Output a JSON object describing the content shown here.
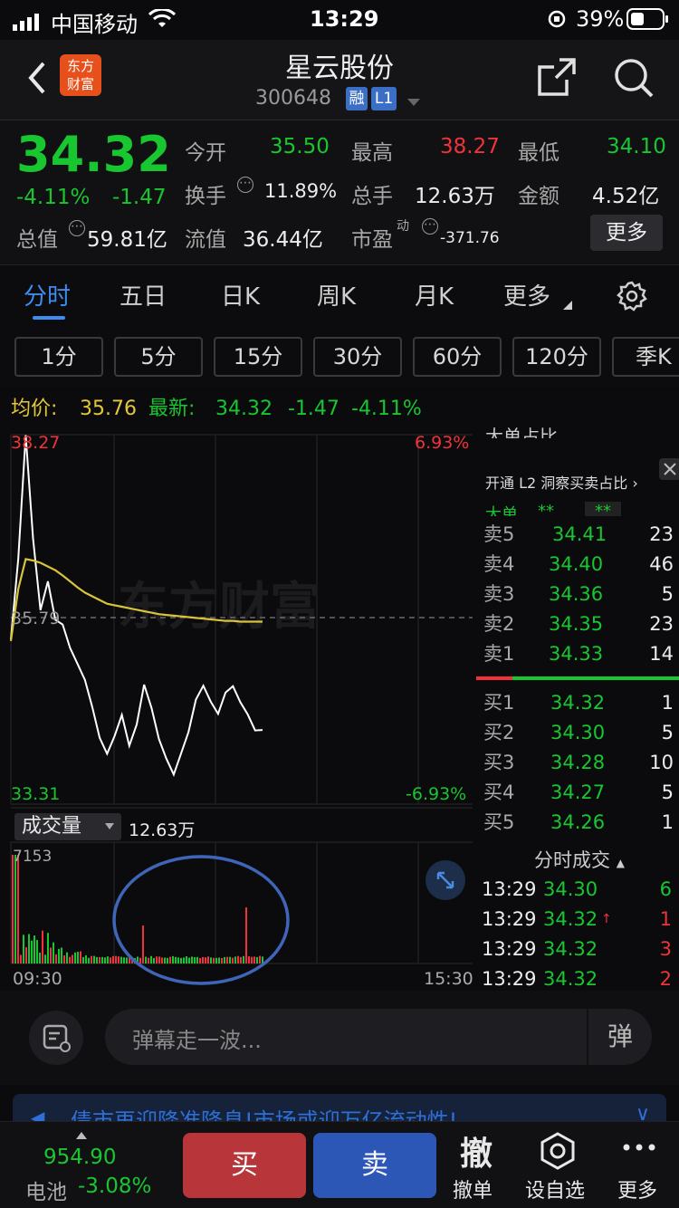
{
  "status_bar": {
    "carrier": "中国移动",
    "time": "13:29",
    "battery": "39%"
  },
  "header": {
    "title": "星云股份",
    "code": "300648",
    "badge_margin": "融",
    "badge_level": "L1",
    "logo_line1": "东方",
    "logo_line2": "财富"
  },
  "quote": {
    "price": "34.32",
    "change_pct": "-4.11%",
    "change": "-1.47",
    "total_value_label": "总值",
    "total_value": "59.81亿",
    "open_label": "今开",
    "open": "35.50",
    "high_label": "最高",
    "high": "38.27",
    "low_label": "最低",
    "low": "34.10",
    "turnover_label": "换手",
    "turnover": "11.89%",
    "volume_label": "总手",
    "volume": "12.63万",
    "amount_label": "金额",
    "amount": "4.52亿",
    "float_label": "流值",
    "float_value": "36.44亿",
    "pe_label": "市盈",
    "pe_sup": "动",
    "pe": "-371.76",
    "more_label": "更多"
  },
  "tabs": [
    "分时",
    "五日",
    "日K",
    "周K",
    "月K",
    "更多"
  ],
  "period_tabs": [
    "1分",
    "5分",
    "15分",
    "30分",
    "60分",
    "120分",
    "季K"
  ],
  "info_bar": {
    "avg_label": "均价:",
    "avg": "35.76",
    "latest_label": "最新:",
    "latest": "34.32",
    "change": "-1.47",
    "change_pct": "-4.11%"
  },
  "chart": {
    "top_price": "38.27",
    "top_pct": "6.93%",
    "mid_price": "35.79",
    "bottom_price": "33.31",
    "bottom_pct": "-6.93%",
    "watermark": "东方财富",
    "volume_selector": "成交量",
    "volume_total": "12.63万",
    "volume_max": "7153",
    "time_start": "09:30",
    "time_end": "15:30",
    "colors": {
      "price": "#ffffff",
      "avg": "#d9c33a",
      "up": "#f0333a",
      "down": "#18c630"
    }
  },
  "chart_data": {
    "type": "line",
    "title": "",
    "xlabel": "",
    "ylabel": "",
    "ylim": [
      33.31,
      38.27
    ],
    "series": [
      {
        "values": [
          35.5,
          36.6,
          38.27,
          36.9,
          35.9,
          36.3,
          35.8,
          35.7,
          35.4,
          35.2,
          35.0,
          34.6,
          34.2,
          34.0,
          34.2,
          34.5,
          34.1,
          34.4,
          34.9,
          34.6,
          34.2,
          33.9,
          33.7,
          34.0,
          34.3,
          34.7,
          34.9,
          34.7,
          34.5,
          34.8,
          34.9,
          34.7,
          34.5,
          34.3,
          34.32
        ]
      },
      {
        "values": [
          35.5,
          36.2,
          36.6,
          36.58,
          36.55,
          36.5,
          36.45,
          36.38,
          36.3,
          36.22,
          36.15,
          36.1,
          36.05,
          36.0,
          35.98,
          35.96,
          35.94,
          35.92,
          35.9,
          35.88,
          35.86,
          35.85,
          35.84,
          35.83,
          35.82,
          35.81,
          35.8,
          35.79,
          35.78,
          35.77,
          35.77,
          35.76,
          35.76,
          35.76,
          35.76
        ]
      }
    ]
  },
  "order_book": {
    "top_partial_label": "大单占比",
    "l2_prompt": "开通 L2 洞察买卖占比",
    "big_order_label": "大单",
    "masked_value": "**",
    "sell": [
      {
        "label": "卖5",
        "price": "34.41",
        "vol": "23"
      },
      {
        "label": "卖4",
        "price": "34.40",
        "vol": "46"
      },
      {
        "label": "卖3",
        "price": "34.36",
        "vol": "5"
      },
      {
        "label": "卖2",
        "price": "34.35",
        "vol": "23"
      },
      {
        "label": "卖1",
        "price": "34.33",
        "vol": "14"
      }
    ],
    "buy": [
      {
        "label": "买1",
        "price": "34.32",
        "vol": "1"
      },
      {
        "label": "买2",
        "price": "34.30",
        "vol": "5"
      },
      {
        "label": "买3",
        "price": "34.28",
        "vol": "10"
      },
      {
        "label": "买4",
        "price": "34.27",
        "vol": "5"
      },
      {
        "label": "买5",
        "price": "34.26",
        "vol": "1"
      }
    ],
    "trades_label": "分时成交",
    "trades": [
      {
        "time": "13:29",
        "price": "34.30",
        "vol": "6"
      },
      {
        "time": "13:29",
        "price": "34.32",
        "vol": "1"
      },
      {
        "time": "13:29",
        "price": "34.32",
        "vol": "3"
      },
      {
        "time": "13:29",
        "price": "34.32",
        "vol": "2"
      }
    ]
  },
  "danmu": {
    "placeholder": "弹幕走一波...",
    "button": "弹"
  },
  "news_ticker": "债市再迎降准降息!市场或迎万亿流动性!",
  "bottom": {
    "index_value": "954.90",
    "index_name": "电池",
    "index_change": "-3.08%",
    "buy": "买",
    "sell": "卖",
    "cancel_icon": "撤",
    "cancel": "撤单",
    "watchlist": "设自选",
    "more": "更多"
  }
}
